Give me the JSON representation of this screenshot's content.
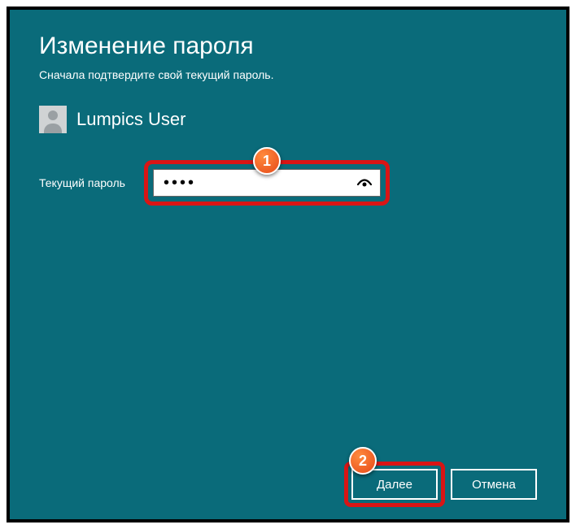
{
  "header": {
    "title": "Изменение пароля",
    "subtitle": "Сначала подтвердите свой текущий пароль."
  },
  "user": {
    "name": "Lumpics User"
  },
  "form": {
    "current_password_label": "Текущий пароль",
    "current_password_value": "••••"
  },
  "buttons": {
    "next": "Далее",
    "cancel": "Отмена"
  },
  "callouts": {
    "one": "1",
    "two": "2"
  }
}
